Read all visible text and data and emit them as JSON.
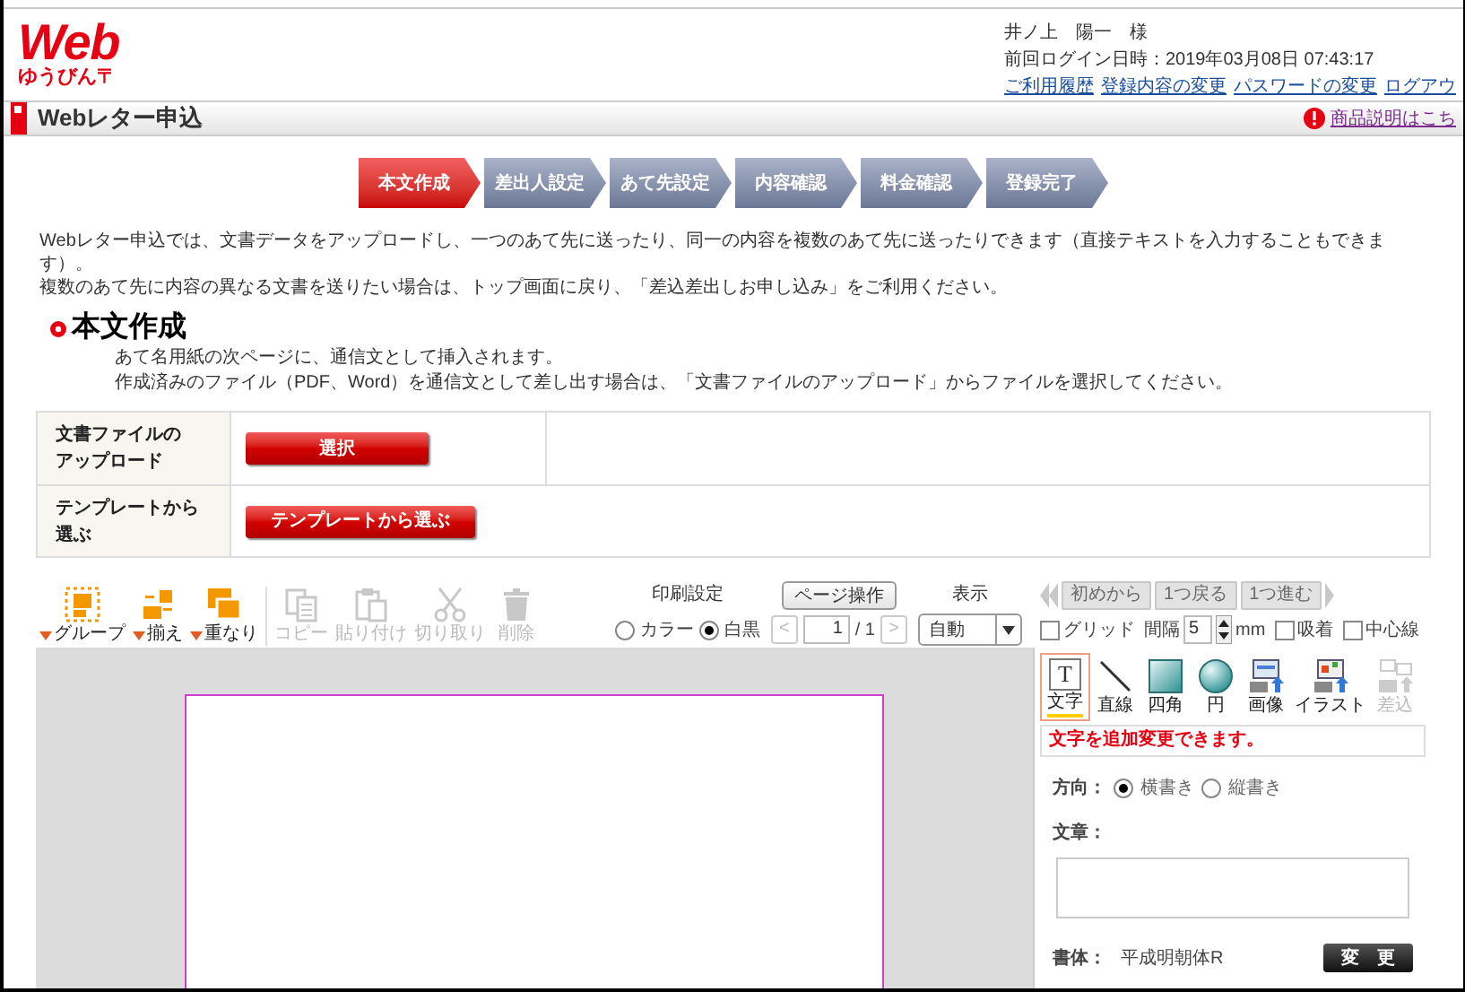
{
  "header": {
    "logo": {
      "title": "Web",
      "subtitle": "ゆうびん〒"
    },
    "user_name": "井ノ上　陽一　様",
    "last_login": "前回ログイン日時：2019年03月08日 07:43:17",
    "links": [
      "ご利用履歴",
      "登録内容の変更",
      "パスワードの変更",
      "ログアウ"
    ]
  },
  "title_bar": {
    "title": "Webレター申込",
    "help_link": "商品説明はこち"
  },
  "steps": [
    {
      "label": "本文作成",
      "selected": true
    },
    {
      "label": "差出人設定",
      "selected": false
    },
    {
      "label": "あて先設定",
      "selected": false
    },
    {
      "label": "内容確認",
      "selected": false
    },
    {
      "label": "料金確認",
      "selected": false
    },
    {
      "label": "登録完了",
      "selected": false
    }
  ],
  "intro": [
    "Webレター申込では、文書データをアップロードし、一つのあて先に送ったり、同一の内容を複数のあて先に送ったりできます（直接テキストを入力することもできます）。",
    "複数のあて先に内容の異なる文書を送りたい場合は、トップ画面に戻り、「差込差出しお申し込み」をご利用ください。"
  ],
  "section": {
    "title": "本文作成",
    "notes": [
      "あて名用紙の次ページに、通信文として挿入されます。",
      "作成済みのファイル（PDF、Word）を通信文として差し出す場合は、「文書ファイルのアップロード」からファイルを選択してください。"
    ]
  },
  "upload_table": {
    "rows": [
      {
        "label_lines": [
          "文書ファイルの",
          "アップロード"
        ],
        "button": "選択"
      },
      {
        "label_lines": [
          "テンプレートから",
          "選ぶ"
        ],
        "button": "テンプレートから選ぶ"
      }
    ]
  },
  "editor": {
    "arrange_tools": [
      {
        "kind": "group",
        "label": "グループ",
        "menu": true,
        "disabled": false
      },
      {
        "kind": "align",
        "label": "揃え",
        "menu": true,
        "disabled": false
      },
      {
        "kind": "overlap",
        "label": "重なり",
        "menu": true,
        "disabled": false
      }
    ],
    "edit_tools": [
      {
        "kind": "copy",
        "label": "コピー",
        "menu": false,
        "disabled": true
      },
      {
        "kind": "paste",
        "label": "貼り付け",
        "menu": false,
        "disabled": true
      },
      {
        "kind": "cut",
        "label": "切り取り",
        "menu": false,
        "disabled": true
      },
      {
        "kind": "delete",
        "label": "削除",
        "menu": false,
        "disabled": true
      }
    ],
    "print": {
      "label": "印刷設定",
      "options": [
        {
          "label": "カラー",
          "selected": false
        },
        {
          "label": "白黒",
          "selected": true
        }
      ]
    },
    "page_nav": {
      "button": "ページ操作",
      "prev": "<",
      "page": "1",
      "total": "/ 1",
      "next": ">"
    },
    "view": {
      "label": "表示",
      "value": "自動"
    },
    "history": [
      {
        "label": "初めから",
        "disabled": true
      },
      {
        "label": "1つ戻る",
        "disabled": true
      },
      {
        "label": "1つ進む",
        "disabled": true
      }
    ],
    "options": [
      {
        "kind": "checkbox",
        "label": "グリッド",
        "checked": false
      },
      {
        "kind": "spinner",
        "label": "間隔",
        "value": "5",
        "unit": "mm"
      },
      {
        "kind": "checkbox",
        "label": "吸着",
        "checked": false
      },
      {
        "kind": "checkbox",
        "label": "中心線",
        "checked": false
      }
    ],
    "panel": {
      "tools": [
        {
          "kind": "text",
          "icon": "T",
          "label": "文字",
          "selected": true,
          "disabled": false
        },
        {
          "kind": "line",
          "label": "直線",
          "selected": false,
          "disabled": false
        },
        {
          "kind": "rect",
          "label": "四角",
          "selected": false,
          "disabled": false
        },
        {
          "kind": "circle",
          "label": "円",
          "selected": false,
          "disabled": false
        },
        {
          "kind": "image",
          "label": "画像",
          "selected": false,
          "disabled": false
        },
        {
          "kind": "illustration",
          "label": "イラスト",
          "selected": false,
          "disabled": false
        },
        {
          "kind": "insert",
          "label": "差込",
          "selected": false,
          "disabled": true
        }
      ],
      "message": "文字を追加変更できます。",
      "direction": {
        "label": "方向：",
        "options": [
          {
            "label": "横書き",
            "selected": true
          },
          {
            "label": "縦書き",
            "selected": false
          }
        ]
      },
      "text_label": "文章：",
      "font": {
        "label": "書体：",
        "value": "平成明朝体R",
        "button": "変　更"
      }
    }
  }
}
